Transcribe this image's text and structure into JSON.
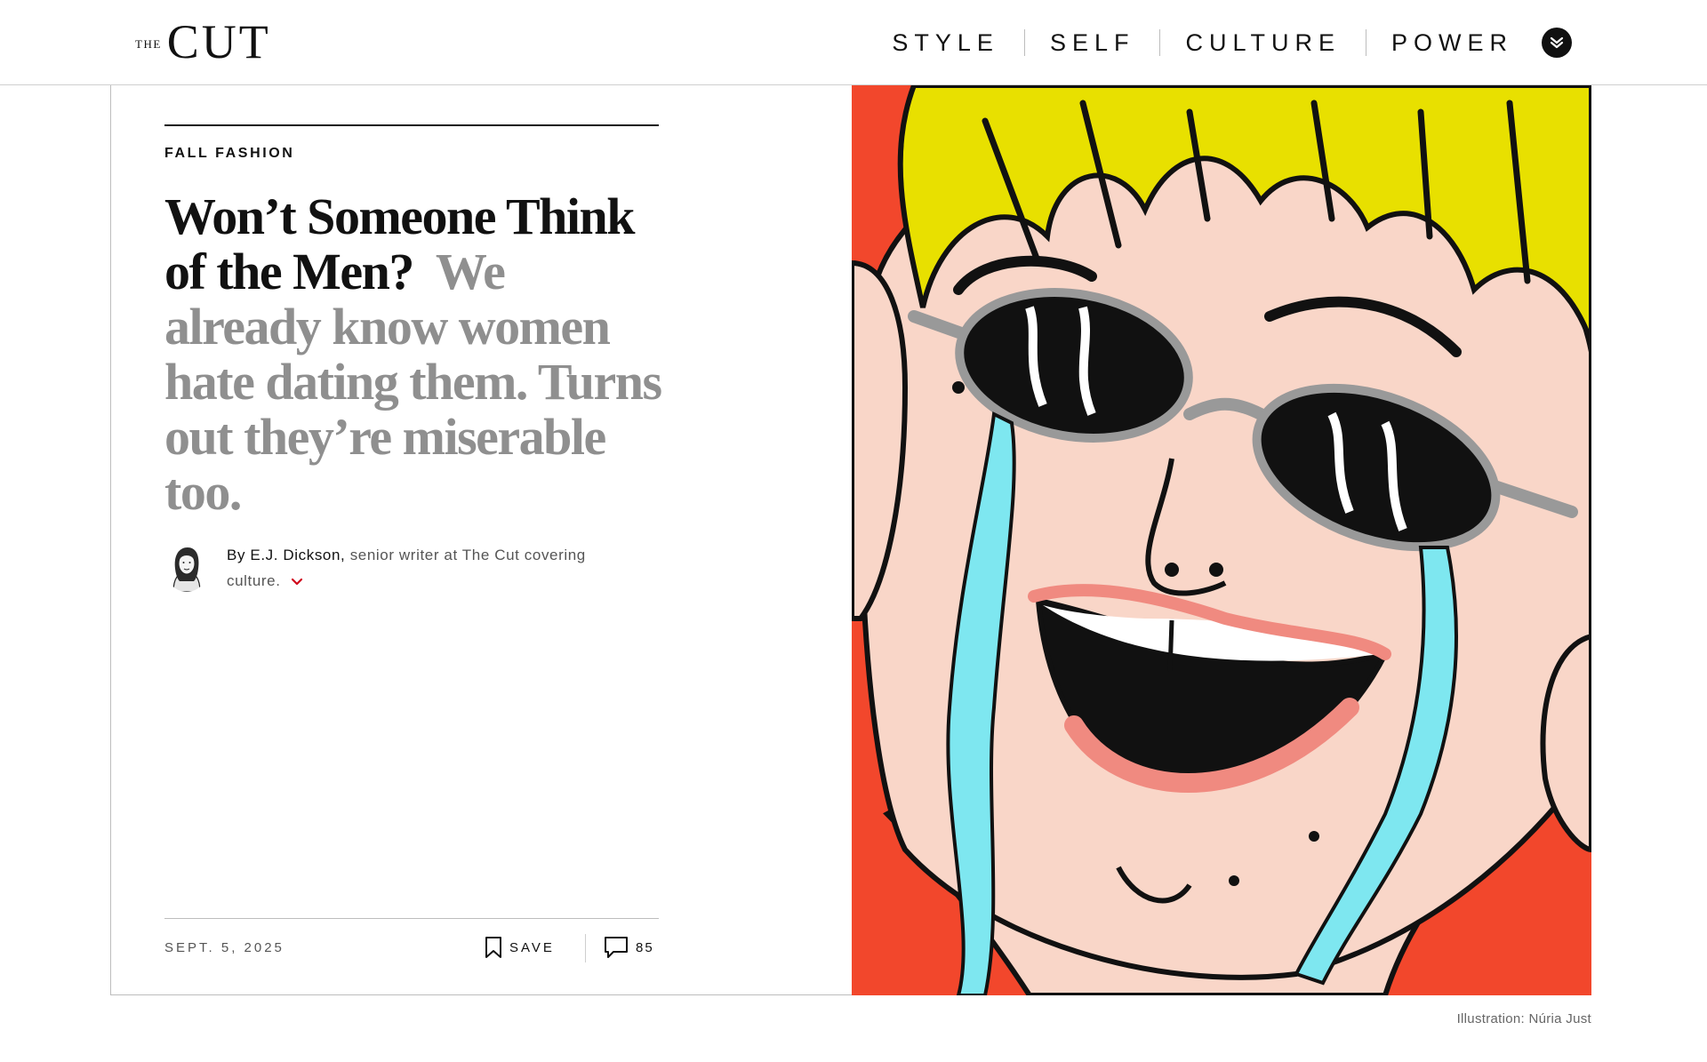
{
  "header": {
    "logo_the": "THE",
    "logo_cut": "CUT",
    "nav": [
      "STYLE",
      "SELF",
      "CULTURE",
      "POWER"
    ],
    "menu_toggle_icon": "chevron-down-circle-icon"
  },
  "article": {
    "rubric": "FALL FASHION",
    "headline": "Won’t Someone Think of the Men?",
    "dek": "We already know women hate dating them. Turns out they’re miserable too.",
    "byline": {
      "prefix": "By",
      "author": "E.J. Dickson,",
      "description": "senior writer at The Cut covering culture."
    },
    "date": "SEPT. 5, 2025",
    "save_label": "SAVE",
    "comment_count": "85"
  },
  "illustration": {
    "credit": "Illustration: Núria Just"
  },
  "colors": {
    "accent_red": "#d0021b",
    "dek_gray": "#8f8f8f",
    "illustration_bg": "#f2472c"
  }
}
